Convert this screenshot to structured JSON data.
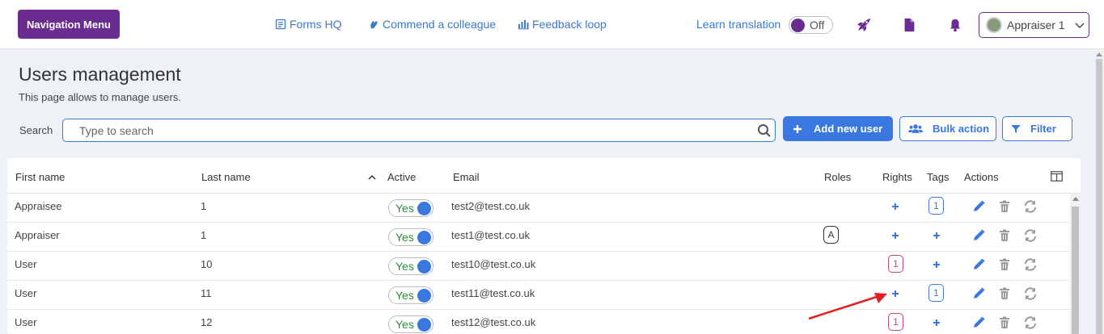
{
  "topbar": {
    "nav_menu": "Navigation Menu",
    "links": {
      "forms": "Forms HQ",
      "commend": "Commend a colleague",
      "feedback": "Feedback loop"
    },
    "learn_translation": "Learn translation",
    "translation_toggle": "Off",
    "user_menu": "Appraiser 1",
    "colors": {
      "brand": "#6a2c91",
      "link": "#3a78c9"
    }
  },
  "page": {
    "title": "Users management",
    "description": "This page allows to manage users."
  },
  "search": {
    "label": "Search",
    "placeholder": "Type to search"
  },
  "buttons": {
    "add_user": "Add new user",
    "bulk_action": "Bulk action",
    "filter": "Filter"
  },
  "table": {
    "headers": {
      "first_name": "First name",
      "last_name": "Last name",
      "active": "Active",
      "email": "Email",
      "roles": "Roles",
      "rights": "Rights",
      "tags": "Tags",
      "actions": "Actions"
    },
    "rows": [
      {
        "first": "Appraisee",
        "last": "1",
        "active": "Yes",
        "email": "test2@test.co.uk",
        "role": "",
        "rights": "",
        "tags": "1"
      },
      {
        "first": "Appraiser",
        "last": "1",
        "active": "Yes",
        "email": "test1@test.co.uk",
        "role": "A",
        "rights": "",
        "tags": ""
      },
      {
        "first": "User",
        "last": "10",
        "active": "Yes",
        "email": "test10@test.co.uk",
        "role": "",
        "rights": "1",
        "tags": ""
      },
      {
        "first": "User",
        "last": "11",
        "active": "Yes",
        "email": "test11@test.co.uk",
        "role": "",
        "rights": "",
        "tags": "1"
      },
      {
        "first": "User",
        "last": "12",
        "active": "Yes",
        "email": "test12@test.co.uk",
        "role": "",
        "rights": "1",
        "tags": ""
      }
    ]
  }
}
